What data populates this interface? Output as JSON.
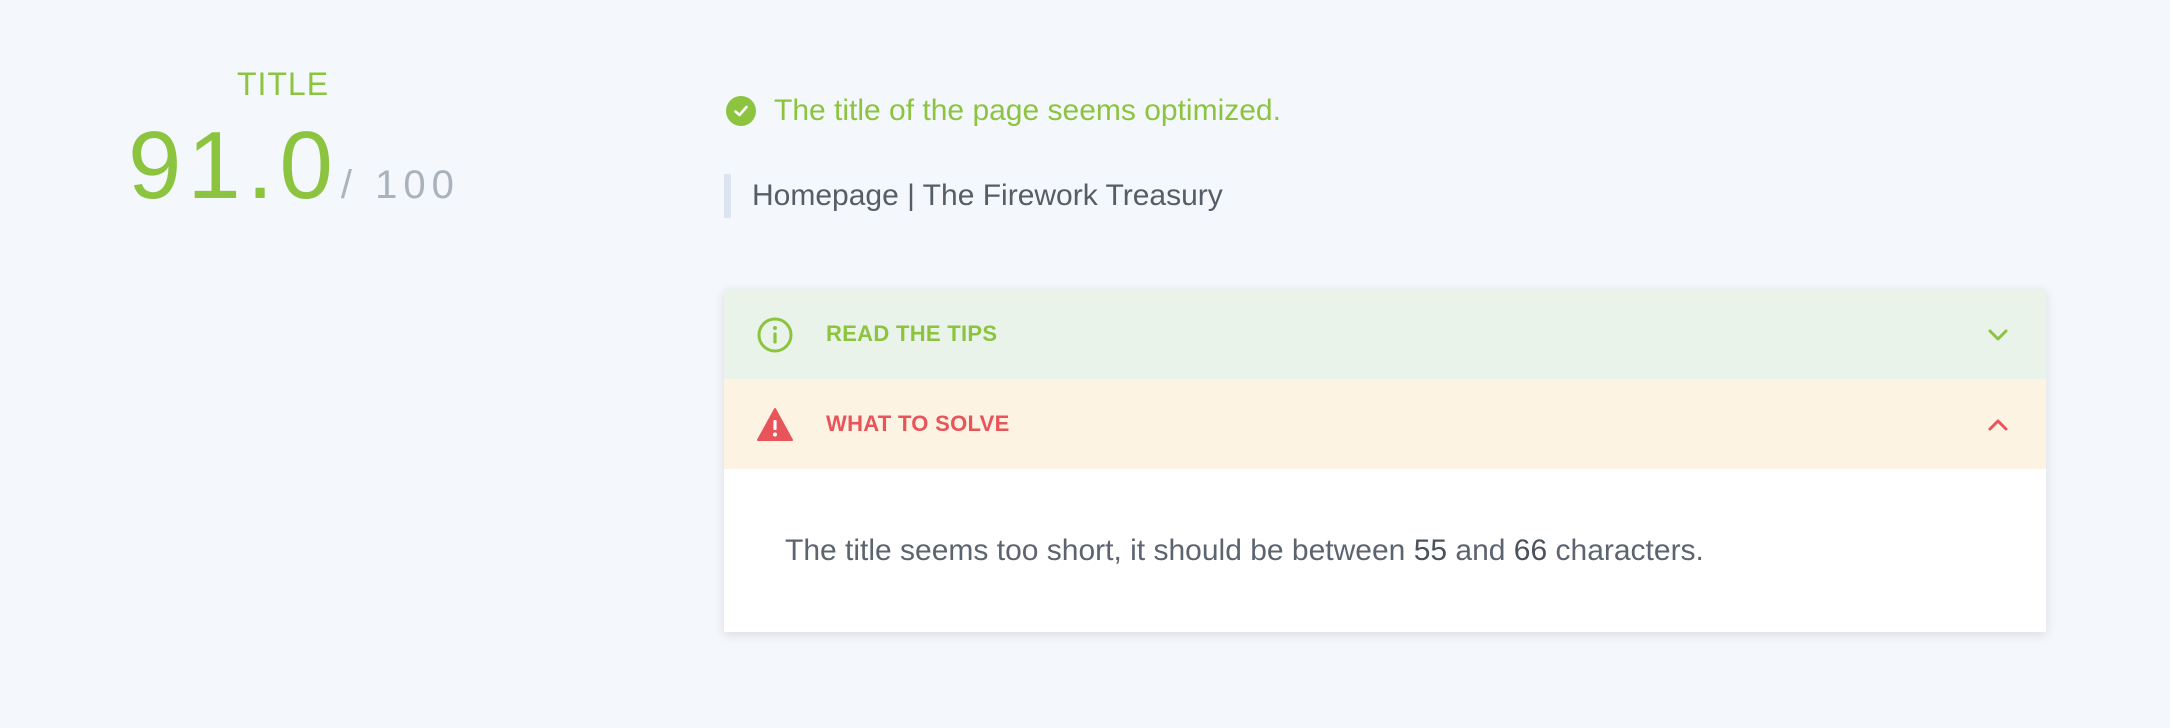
{
  "score": {
    "label": "TITLE",
    "value": "91.0",
    "max": "/ 100"
  },
  "status": {
    "icon": "check-circle-icon",
    "text": "The title of the page seems optimized."
  },
  "page_title": {
    "text": "Homepage | The Firework Treasury"
  },
  "accordion": {
    "tips": {
      "label": "READ THE TIPS",
      "icon": "info-circle-icon",
      "chevron": "chevron-down-icon",
      "expanded": false
    },
    "solve": {
      "label": "WHAT TO SOLVE",
      "icon": "warning-triangle-icon",
      "chevron": "chevron-up-icon",
      "expanded": true,
      "message": {
        "prefix": "The title seems too short, it should be between ",
        "min": "55",
        "middle": " and ",
        "max": "66",
        "suffix": " characters."
      }
    }
  },
  "colors": {
    "accent_green": "#8cc43f",
    "alert_red": "#e8545a",
    "tips_bg": "#e9f3e9",
    "solve_bg": "#fdf3e3",
    "page_bg": "#f4f7fb"
  }
}
